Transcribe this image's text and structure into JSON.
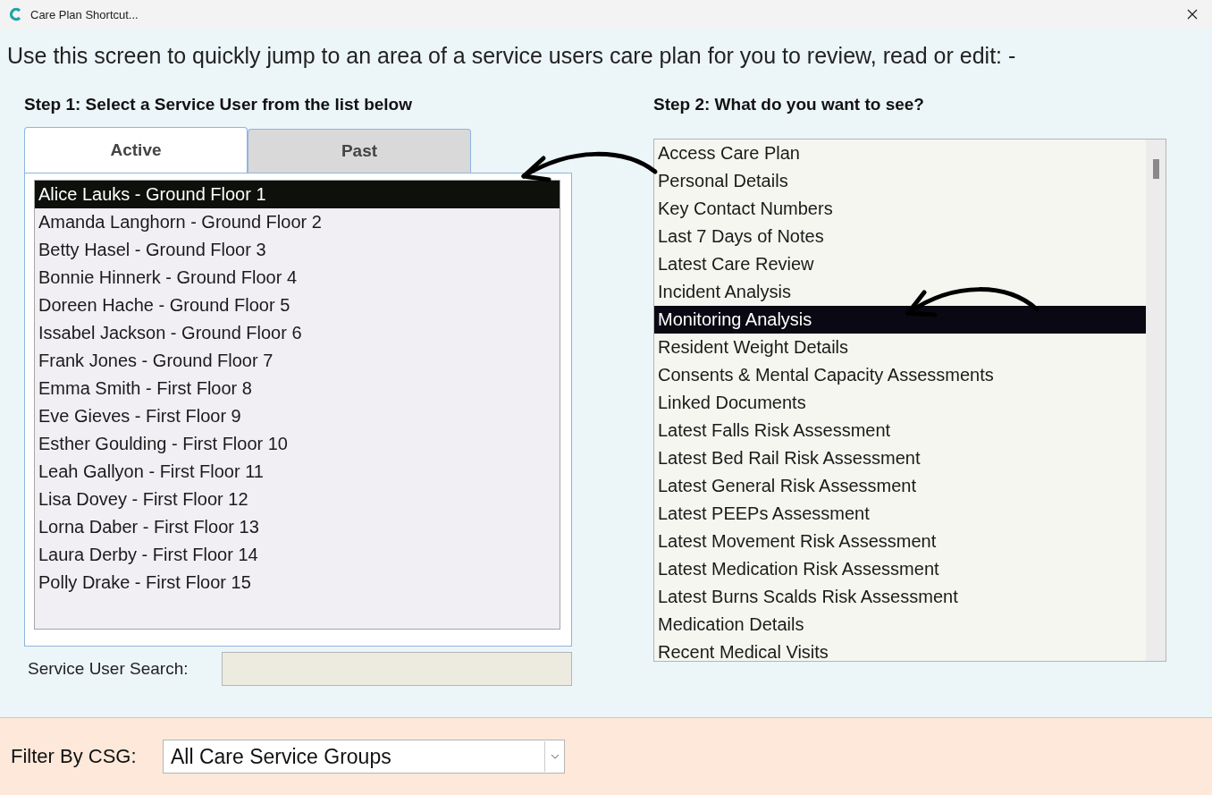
{
  "window": {
    "title": "Care Plan Shortcut..."
  },
  "instruction": "Use this screen to quickly jump to an area of a service users care plan for you to review, read or edit: -",
  "step1": {
    "label": "Step 1: Select a Service User from the list below",
    "tabs": [
      {
        "label": "Active",
        "selected": true
      },
      {
        "label": "Past",
        "selected": false
      }
    ],
    "service_users": [
      {
        "label": "Alice Lauks - Ground Floor 1",
        "selected": true
      },
      {
        "label": "Amanda Langhorn - Ground Floor 2",
        "selected": false
      },
      {
        "label": "Betty Hasel - Ground Floor 3",
        "selected": false
      },
      {
        "label": "Bonnie Hinnerk - Ground Floor 4",
        "selected": false
      },
      {
        "label": "Doreen Hache - Ground Floor 5",
        "selected": false
      },
      {
        "label": "Issabel Jackson - Ground Floor 6",
        "selected": false
      },
      {
        "label": "Frank Jones - Ground Floor 7",
        "selected": false
      },
      {
        "label": "Emma Smith - First Floor 8",
        "selected": false
      },
      {
        "label": "Eve Gieves - First Floor 9",
        "selected": false
      },
      {
        "label": "Esther Goulding - First Floor 10",
        "selected": false
      },
      {
        "label": "Leah Gallyon - First Floor 11",
        "selected": false
      },
      {
        "label": "Lisa Dovey - First Floor 12",
        "selected": false
      },
      {
        "label": "Lorna Daber - First Floor 13",
        "selected": false
      },
      {
        "label": "Laura Derby - First Floor 14",
        "selected": false
      },
      {
        "label": "Polly Drake - First Floor 15",
        "selected": false
      }
    ],
    "search_label": "Service User Search:"
  },
  "step2": {
    "label": "Step 2: What do you want to see?",
    "options": [
      {
        "label": "Access Care Plan",
        "selected": false
      },
      {
        "label": "Personal Details",
        "selected": false
      },
      {
        "label": "Key Contact Numbers",
        "selected": false
      },
      {
        "label": "Last 7 Days of Notes",
        "selected": false
      },
      {
        "label": "Latest Care Review",
        "selected": false
      },
      {
        "label": "Incident Analysis",
        "selected": false
      },
      {
        "label": "Monitoring Analysis",
        "selected": true
      },
      {
        "label": "Resident Weight Details",
        "selected": false
      },
      {
        "label": "Consents & Mental Capacity Assessments",
        "selected": false
      },
      {
        "label": "Linked Documents",
        "selected": false
      },
      {
        "label": "Latest Falls Risk Assessment",
        "selected": false
      },
      {
        "label": "Latest Bed Rail Risk Assessment",
        "selected": false
      },
      {
        "label": "Latest General Risk Assessment",
        "selected": false
      },
      {
        "label": "Latest PEEPs Assessment",
        "selected": false
      },
      {
        "label": "Latest Movement Risk Assessment",
        "selected": false
      },
      {
        "label": "Latest Medication Risk Assessment",
        "selected": false
      },
      {
        "label": "Latest Burns Scalds Risk Assessment",
        "selected": false
      },
      {
        "label": "Medication Details",
        "selected": false
      },
      {
        "label": "Recent Medical Visits",
        "selected": false
      }
    ]
  },
  "filter": {
    "label": "Filter By CSG:",
    "value": "All Care Service Groups"
  }
}
